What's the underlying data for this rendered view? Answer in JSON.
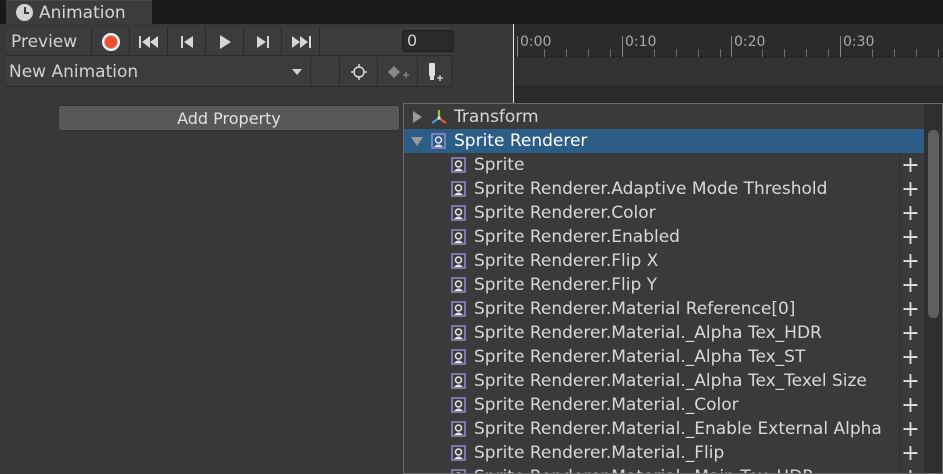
{
  "window": {
    "tab_title": "Animation"
  },
  "toolbar": {
    "preview_label": "Preview",
    "frame_value": "0"
  },
  "clip": {
    "selected": "New Animation"
  },
  "add_property_label": "Add Property",
  "timeline": {
    "ticks": [
      "0:00",
      "0:10",
      "0:20",
      "0:30"
    ]
  },
  "properties": {
    "groups": [
      {
        "label": "Transform",
        "expanded": false
      },
      {
        "label": "Sprite Renderer",
        "expanded": true
      }
    ],
    "items": [
      "Sprite",
      "Sprite Renderer.Adaptive Mode Threshold",
      "Sprite Renderer.Color",
      "Sprite Renderer.Enabled",
      "Sprite Renderer.Flip X",
      "Sprite Renderer.Flip Y",
      "Sprite Renderer.Material Reference[0]",
      "Sprite Renderer.Material._Alpha Tex_HDR",
      "Sprite Renderer.Material._Alpha Tex_ST",
      "Sprite Renderer.Material._Alpha Tex_Texel Size",
      "Sprite Renderer.Material._Color",
      "Sprite Renderer.Material._Enable External Alpha",
      "Sprite Renderer.Material._Flip",
      "Sprite Renderer.Material._Main Tex_HDR"
    ],
    "add_glyph": "+"
  },
  "colors": {
    "selection": "#2c5d87",
    "record": "#f04d2f"
  }
}
